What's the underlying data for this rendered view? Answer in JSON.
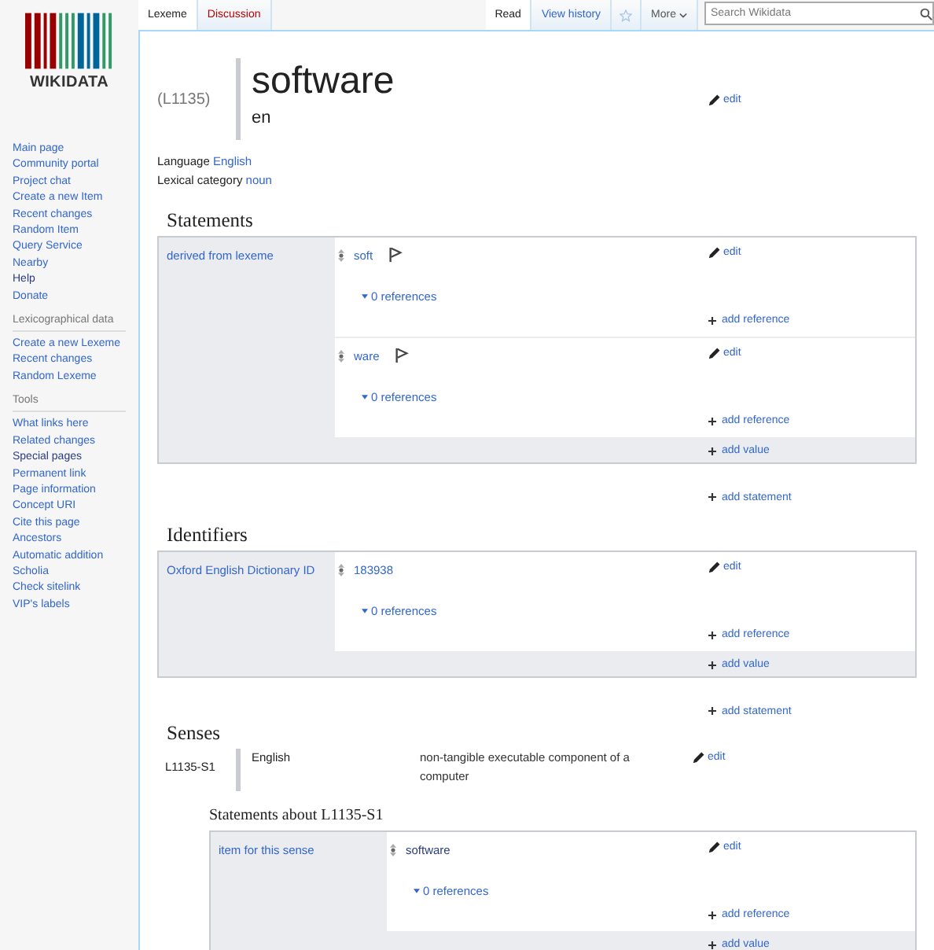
{
  "logo": {
    "text": "WIKIDATA"
  },
  "sidebar": {
    "sections": [
      {
        "items": [
          {
            "label": "Main page",
            "visited": false
          },
          {
            "label": "Community portal",
            "visited": false
          },
          {
            "label": "Project chat",
            "visited": false
          },
          {
            "label": "Create a new Item",
            "visited": false
          },
          {
            "label": "Recent changes",
            "visited": false
          },
          {
            "label": "Random Item",
            "visited": false
          },
          {
            "label": "Query Service",
            "visited": false
          },
          {
            "label": "Nearby",
            "visited": false
          },
          {
            "label": "Help",
            "visited": true
          },
          {
            "label": "Donate",
            "visited": false
          }
        ]
      },
      {
        "heading": "Lexicographical data",
        "items": [
          {
            "label": "Create a new Lexeme",
            "visited": false
          },
          {
            "label": "Recent changes",
            "visited": false
          },
          {
            "label": "Random Lexeme",
            "visited": false
          }
        ]
      },
      {
        "heading": "Tools",
        "items": [
          {
            "label": "What links here",
            "visited": false
          },
          {
            "label": "Related changes",
            "visited": false
          },
          {
            "label": "Special pages",
            "visited": true
          },
          {
            "label": "Permanent link",
            "visited": false
          },
          {
            "label": "Page information",
            "visited": false
          },
          {
            "label": "Concept URI",
            "visited": false
          },
          {
            "label": "Cite this page",
            "visited": false
          },
          {
            "label": "Ancestors",
            "visited": false
          },
          {
            "label": "Automatic addition",
            "visited": false
          },
          {
            "label": "Scholia",
            "visited": false
          },
          {
            "label": "Check sitelink",
            "visited": false
          },
          {
            "label": "VIP's labels",
            "visited": false
          }
        ]
      }
    ]
  },
  "tabs_left": [
    {
      "label": "Lexeme",
      "selected": true,
      "missing": false
    },
    {
      "label": "Discussion",
      "selected": false,
      "missing": true
    }
  ],
  "tabs_right": [
    {
      "label": "Read",
      "selected": true
    },
    {
      "label": "View history",
      "selected": false
    }
  ],
  "more_menu": {
    "label": "More"
  },
  "search": {
    "placeholder": "Search Wikidata"
  },
  "lexeme": {
    "id": "(L1135)",
    "lemma": "software",
    "lemma_language": "en",
    "edit": "edit",
    "language_label": "Language",
    "language": "English",
    "category_label": "Lexical category",
    "category": "noun"
  },
  "statements": {
    "heading": "Statements",
    "groups": [
      {
        "property": "derived from lexeme",
        "values": [
          {
            "value": "soft",
            "visited": false,
            "flag": true,
            "references": "0 references",
            "edit": "edit",
            "add_reference": "add reference"
          },
          {
            "value": "ware",
            "visited": false,
            "flag": true,
            "references": "0 references",
            "edit": "edit",
            "add_reference": "add reference"
          }
        ],
        "add_value": "add value"
      }
    ],
    "add_statement": "add statement"
  },
  "identifiers": {
    "heading": "Identifiers",
    "groups": [
      {
        "property": "Oxford English Dictionary ID",
        "values": [
          {
            "value": "183938",
            "visited": false,
            "flag": false,
            "references": "0 references",
            "edit": "edit",
            "add_reference": "add reference"
          }
        ],
        "add_value": "add value"
      }
    ],
    "add_statement": "add statement"
  },
  "senses": {
    "heading": "Senses",
    "items": [
      {
        "id": "L1135-S1",
        "language": "English",
        "gloss": "non-tangible executable component of a computer",
        "edit": "edit",
        "statements_heading": "Statements about L1135-S1",
        "groups": [
          {
            "property": "item for this sense",
            "values": [
              {
                "value": "software",
                "visited": true,
                "flag": false,
                "references": "0 references",
                "edit": "edit",
                "add_reference": "add reference"
              }
            ],
            "add_value": "add value"
          }
        ]
      }
    ]
  }
}
